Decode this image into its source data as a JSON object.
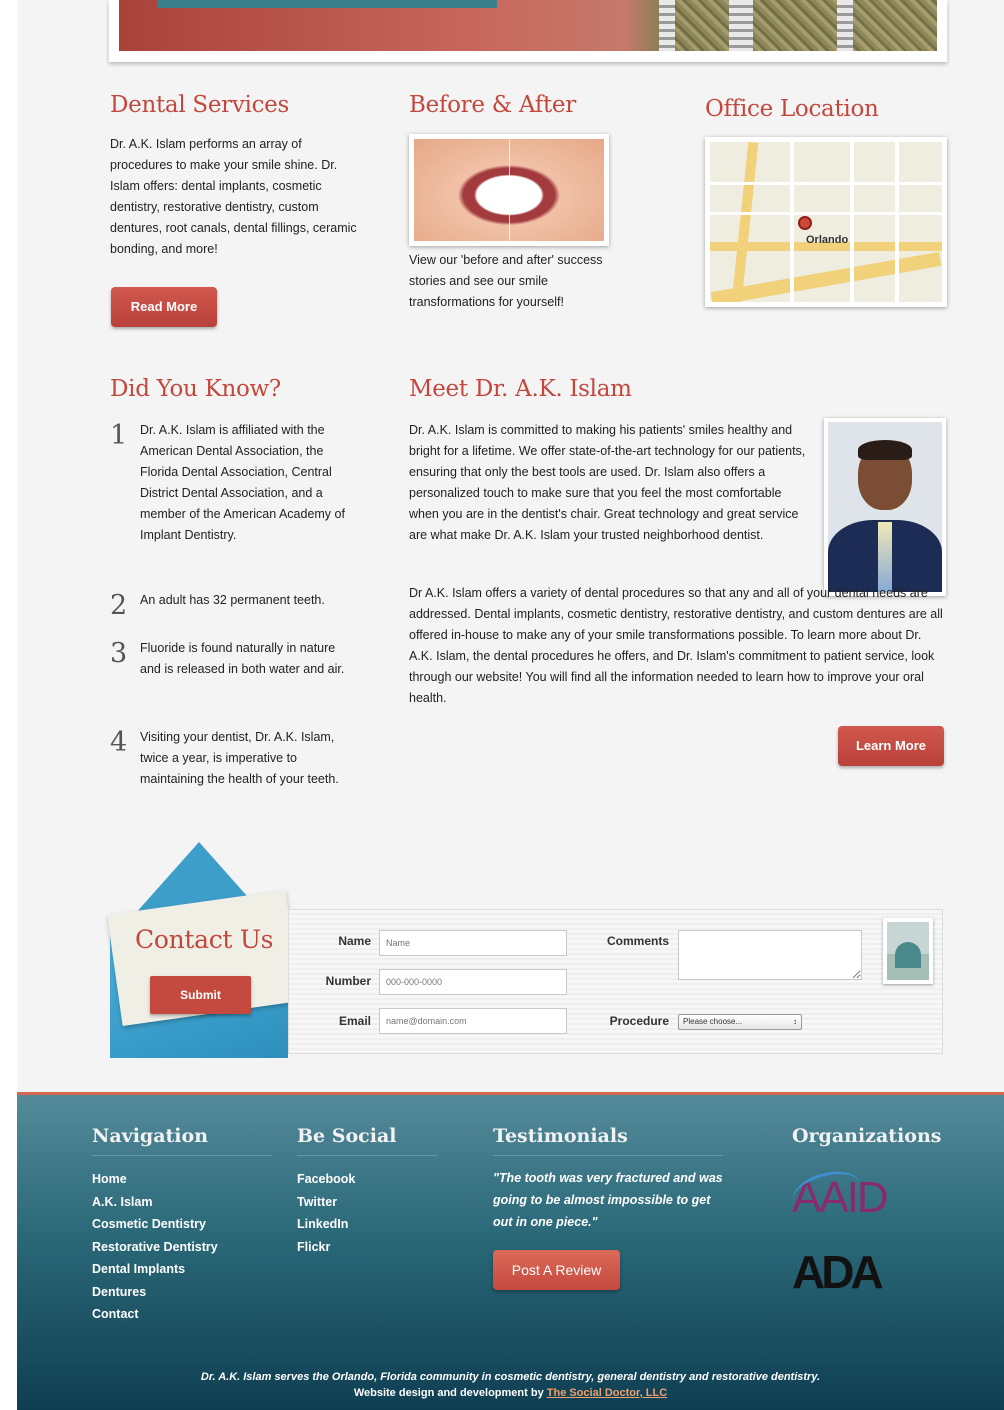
{
  "dental_services": {
    "title": "Dental Services",
    "text": "Dr. A.K. Islam performs an array of procedures to make your smile shine. Dr. Islam offers: dental implants, cosmetic dentistry, restorative dentistry, custom dentures, root canals, dental fillings, ceramic bonding, and more!",
    "button": "Read More"
  },
  "before_after": {
    "title": "Before & After",
    "text": "View our 'before and after' success stories and see our smile transformations for yourself!"
  },
  "office_location": {
    "title": "Office Location",
    "map_label": "Orlando"
  },
  "did_you_know": {
    "title": "Did You Know?",
    "facts": [
      {
        "num": "1",
        "text": "Dr. A.K. Islam is affiliated with the American Dental Association, the Florida Dental Association, Central District Dental Association, and a member of the American Academy of Implant Dentistry."
      },
      {
        "num": "2",
        "text": "An adult has 32 permanent teeth."
      },
      {
        "num": "3",
        "text": "Fluoride is found naturally in nature and is released in both water and air."
      },
      {
        "num": "4",
        "text": "Visiting your dentist, Dr. A.K. Islam, twice a year, is imperative to maintaining the health of your teeth."
      }
    ]
  },
  "meet": {
    "title": "Meet Dr. A.K. Islam",
    "p1": "Dr. A.K. Islam is committed to making his patients' smiles healthy and bright for a lifetime. We offer state-of-the-art technology for our patients, ensuring that only the best tools are used. Dr. Islam also offers a personalized touch to make sure that you feel the most comfortable when you are in the dentist's chair. Great technology and great service are what make Dr. A.K. Islam your trusted neighborhood dentist.",
    "p2": "Dr A.K. Islam offers a variety of dental procedures so that any and all of your dental needs are addressed. Dental implants, cosmetic dentistry, restorative dentistry, and custom dentures are all offered in-house to make any of your smile transformations possible. To learn more about Dr. A.K. Islam, the dental procedures he offers, and Dr. Islam's commitment to patient service, look through our website! You will find all the information needed to learn how to improve your oral health.",
    "button": "Learn More"
  },
  "contact": {
    "title": "Contact Us",
    "submit": "Submit",
    "name_label": "Name",
    "name_placeholder": "Name",
    "number_label": "Number",
    "number_placeholder": "000-000-0000",
    "email_label": "Email",
    "email_placeholder": "name@domain.com",
    "comments_label": "Comments",
    "procedure_label": "Procedure",
    "procedure_selected": "Please choose..."
  },
  "footer": {
    "nav_title": "Navigation",
    "nav_links": [
      "Home",
      "A.K. Islam",
      "Cosmetic Dentistry",
      "Restorative Dentistry",
      "Dental Implants",
      "Dentures",
      "Contact"
    ],
    "social_title": "Be Social",
    "social_links": [
      "Facebook",
      "Twitter",
      "LinkedIn",
      "Flickr"
    ],
    "testimonials_title": "Testimonials",
    "testimonial": "\"The tooth was very fractured and was going to be almost impossible to get out in one piece.\"",
    "review_button": "Post A Review",
    "orgs_title": "Organizations",
    "org1": "AAID",
    "org2": "ADA",
    "tagline": "Dr. A.K. Islam serves the Orlando, Florida community in cosmetic dentistry, general dentistry and restorative dentistry.",
    "credit_prefix": "Website design and development by",
    "credit_link": "The Social Doctor, LLC"
  },
  "colors": {
    "accent_red": "#c3473c",
    "footer_teal": "#2a6878",
    "envelope_blue": "#3d9fc9"
  }
}
